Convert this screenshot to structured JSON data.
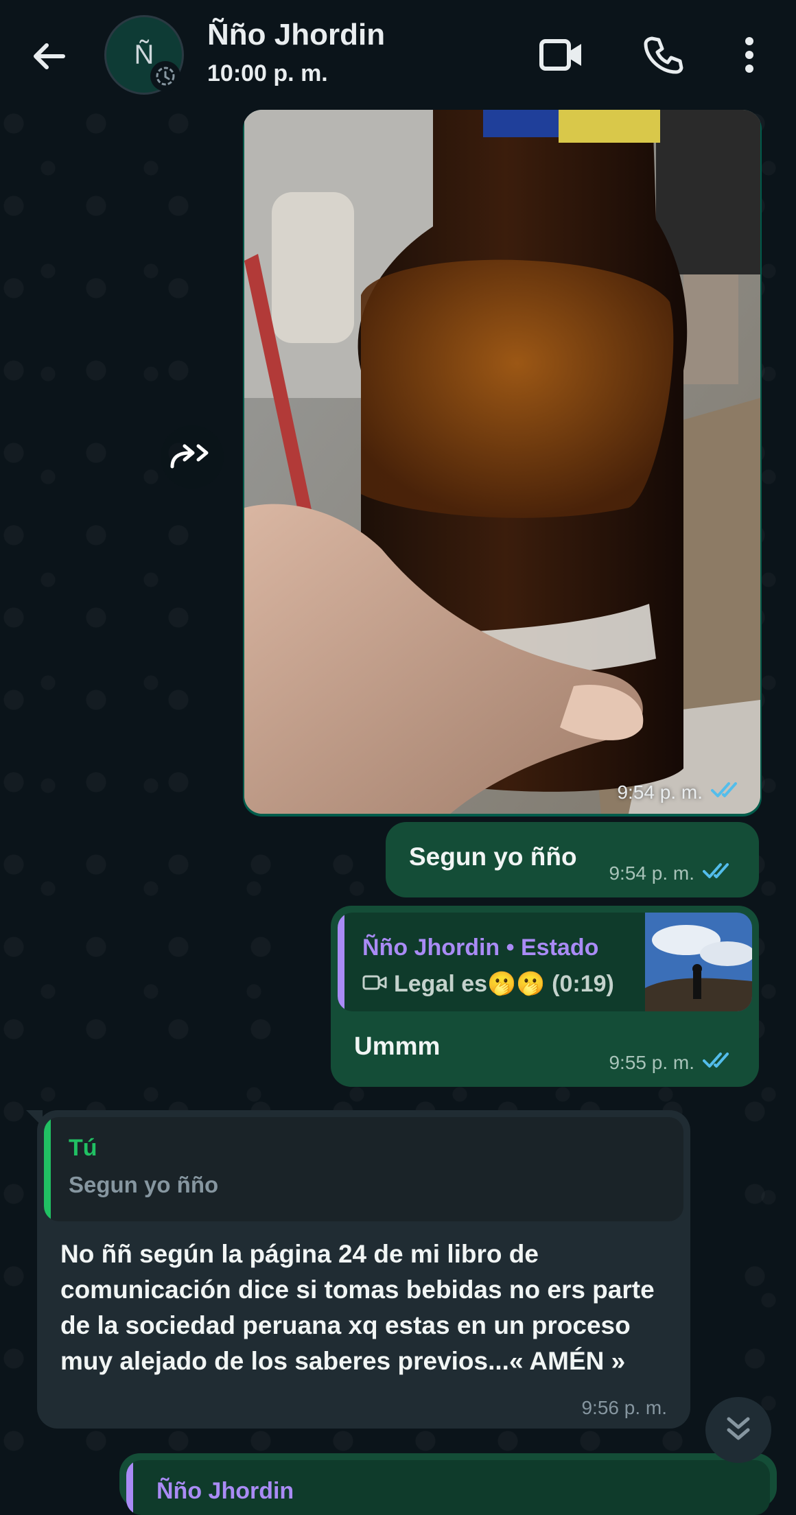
{
  "header": {
    "avatar_initial": "Ñ",
    "contact_name": "Ñño Jhordin",
    "status": "10:00 p. m.",
    "icons": [
      "back-arrow-icon",
      "video-call-icon",
      "voice-call-icon",
      "more-options-icon"
    ]
  },
  "messages": [
    {
      "type": "image",
      "direction": "outgoing",
      "time": "9:54 p. m.",
      "read": true
    },
    {
      "type": "text",
      "direction": "outgoing",
      "text": "Segun yo ñño",
      "time": "9:54 p. m.",
      "read": true
    },
    {
      "type": "reply",
      "direction": "outgoing",
      "quoted_name": "Ñño Jhordin • Estado",
      "quoted_text": "Legal es🫢🫢 (0:19)",
      "text": "Ummm",
      "time": "9:55 p. m.",
      "read": true
    },
    {
      "type": "reply",
      "direction": "incoming",
      "quoted_name": "Tú",
      "quoted_text": "Segun yo ñño",
      "text": "No ññ según la página 24 de mi libro de comunicación dice si tomas bebidas no ers parte de la sociedad peruana xq estas en un proceso muy alejado de los saberes previos...« AMÉN »",
      "time": "9:56 p. m."
    },
    {
      "type": "reply",
      "direction": "outgoing",
      "quoted_name": "Ñño Jhordin",
      "partial": true
    }
  ],
  "colors": {
    "background": "#0b141a",
    "outgoing_bubble": "#144d37",
    "incoming_bubble": "#202c33",
    "read_ticks": "#53bdeb",
    "accent_green": "#21c063",
    "status_quote": "#a98bf5"
  }
}
